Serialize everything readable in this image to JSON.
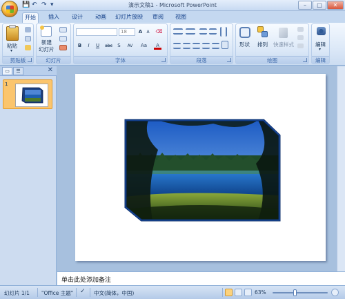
{
  "window": {
    "title": "演示文稿1 - Microsoft PowerPoint",
    "min": "–",
    "max": "□",
    "close": "✕"
  },
  "quick_access": {
    "save": "💾",
    "undo": "↶",
    "redo": "↷",
    "more": "▾"
  },
  "tabs": [
    "开始",
    "插入",
    "设计",
    "动画",
    "幻灯片放映",
    "审阅",
    "视图"
  ],
  "ribbon": {
    "clipboard": {
      "label": "剪贴板",
      "paste": "粘贴"
    },
    "slides": {
      "label": "幻灯片",
      "new_slide_1": "新建",
      "new_slide_2": "幻灯片"
    },
    "font": {
      "label": "字体",
      "font_name": "",
      "font_size": "18",
      "grow": "A",
      "shrink": "A",
      "clear": "⌫",
      "bold": "B",
      "italic": "I",
      "underline": "U",
      "strike": "abc",
      "shadow": "S",
      "spacing": "AV",
      "case": "Aa",
      "color": "A"
    },
    "paragraph": {
      "label": "段落"
    },
    "drawing": {
      "label": "绘图",
      "shapes": "形状",
      "arrange": "排列",
      "quick_styles": "快速样式"
    },
    "editing": {
      "label": "编辑",
      "find": "编辑"
    }
  },
  "left_panel": {
    "x": "✕",
    "slide_number": "1"
  },
  "notes": {
    "placeholder": "单击此处添加备注"
  },
  "status": {
    "slide_info": "幻灯片 1/1",
    "theme": "\"Office 主题\"",
    "language": "中文(简体，中国)",
    "zoom": "63%"
  },
  "colors": {
    "accent": "#15428b",
    "ribbon": "#dde9f8",
    "frame": "#a7c0de"
  }
}
